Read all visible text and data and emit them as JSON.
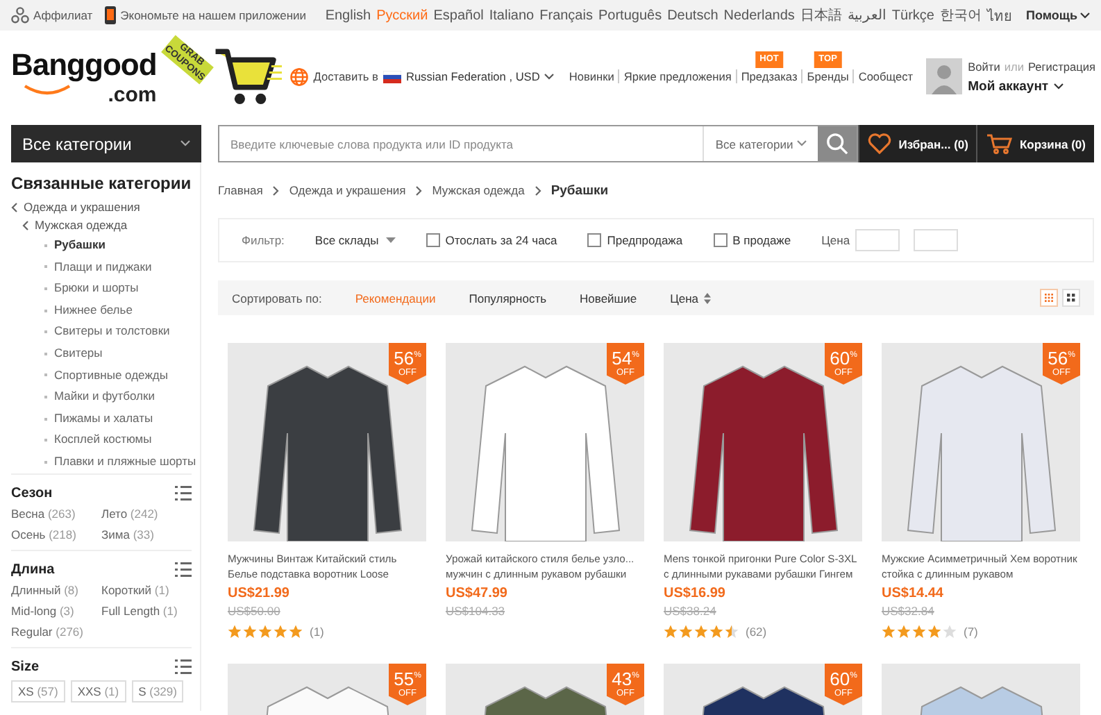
{
  "top_bar": {
    "affiliate": "Аффилиат",
    "app_promo": "Экономьте на нашем приложении",
    "languages": [
      {
        "label": "English",
        "selected": false
      },
      {
        "label": "Русский",
        "selected": true
      },
      {
        "label": "Español",
        "selected": false
      },
      {
        "label": "Italiano",
        "selected": false
      },
      {
        "label": "Français",
        "selected": false
      },
      {
        "label": "Português",
        "selected": false
      },
      {
        "label": "Deutsch",
        "selected": false
      },
      {
        "label": "Nederlands",
        "selected": false
      },
      {
        "label": "日本語",
        "selected": false
      },
      {
        "label": "العربية",
        "selected": false
      },
      {
        "label": "Türkçe",
        "selected": false
      },
      {
        "label": "한국어",
        "selected": false
      },
      {
        "label": "ไทย",
        "selected": false
      }
    ],
    "help": "Помощь"
  },
  "header": {
    "logo": {
      "name": "Banggood",
      "domain": ".com"
    },
    "coupon_ribbon": "GRAB COUPONS",
    "ship_to": {
      "label": "Доставить в",
      "destination": "Russian Federation , USD"
    },
    "nav_links": [
      {
        "label": "Новинки"
      },
      {
        "label": "Яркие предложения"
      },
      {
        "label": "Предзаказ",
        "badge": "HOT"
      },
      {
        "label": "Бренды",
        "badge": "TOP"
      },
      {
        "label": "Сообщест"
      }
    ],
    "account": {
      "login": "Войти",
      "or": "или",
      "register": "Регистрация",
      "title": "Мой аккаунт"
    }
  },
  "nav_bar": {
    "categories_button": "Все категории",
    "search": {
      "placeholder": "Введите ключевые слова продукта или ID продукта",
      "category": "Все категории"
    },
    "wishlist": {
      "label": "Избран...",
      "count": "(0)"
    },
    "cart": {
      "label": "Корзина",
      "count": "(0)"
    }
  },
  "sidebar": {
    "title": "Связанные категории",
    "tree": [
      {
        "label": "Одежда и украшения",
        "children": [
          {
            "label": "Мужская одежда",
            "children": [
              {
                "label": "Рубашки",
                "selected": true
              },
              {
                "label": "Плащи и пиджаки",
                "selected": false
              },
              {
                "label": "Брюки и шорты",
                "selected": false
              },
              {
                "label": "Нижнее белье",
                "selected": false
              },
              {
                "label": "Свитеры и толстовки",
                "selected": false
              },
              {
                "label": "Свитеры",
                "selected": false
              },
              {
                "label": "Спортивные одежды",
                "selected": false
              },
              {
                "label": "Майки и футболки",
                "selected": false
              },
              {
                "label": "Пижамы и халаты",
                "selected": false
              },
              {
                "label": "Косплей костюмы",
                "selected": false
              },
              {
                "label": "Плавки и пляжные шорты",
                "selected": false
              }
            ]
          }
        ]
      }
    ],
    "filters": [
      {
        "title": "Сезон",
        "kind": "options",
        "options": [
          {
            "label": "Весна",
            "count": "(263)"
          },
          {
            "label": "Лето",
            "count": "(242)"
          },
          {
            "label": "Осень",
            "count": "(218)"
          },
          {
            "label": "Зима",
            "count": "(33)"
          }
        ]
      },
      {
        "title": "Длина",
        "kind": "options",
        "options": [
          {
            "label": "Длинный",
            "count": "(8)"
          },
          {
            "label": "Короткий",
            "count": "(1)"
          },
          {
            "label": "Mid-long",
            "count": "(3)"
          },
          {
            "label": "Full Length",
            "count": "(1)"
          },
          {
            "label": "Regular",
            "count": "(276)"
          }
        ]
      },
      {
        "title": "Size",
        "kind": "chips",
        "options": [
          {
            "label": "XS",
            "count": "(57)"
          },
          {
            "label": "XXS",
            "count": "(1)"
          },
          {
            "label": "S",
            "count": "(329)"
          }
        ]
      }
    ]
  },
  "breadcrumb": [
    "Главная",
    "Одежда и украшения",
    "Мужская одежда",
    "Рубашки"
  ],
  "filter_bar": {
    "label": "Фильтр:",
    "warehouse": "Все склады",
    "checkboxes": [
      {
        "label": "Отослать за 24 часа",
        "checked": false
      },
      {
        "label": "Предпродажа",
        "checked": false
      },
      {
        "label": "В продаже",
        "checked": false
      }
    ],
    "price_label": "Цена"
  },
  "sort_bar": {
    "label": "Сортировать по:",
    "options": [
      {
        "label": "Рекомендации",
        "selected": true
      },
      {
        "label": "Популярность",
        "selected": false
      },
      {
        "label": "Новейшие",
        "selected": false
      },
      {
        "label": "Цена",
        "selected": false
      }
    ],
    "views": [
      {
        "kind": "small-grid",
        "selected": true
      },
      {
        "kind": "large-grid",
        "selected": false
      }
    ]
  },
  "products": [
    {
      "color": "#3b3e42",
      "discount": "56$^{%}$",
      "badge_label": "OFF",
      "title": "Мужчины Винтаж Китайский стиль Белье подставка воротник Loose",
      "price": "US$21.99",
      "old_price": "US$50.00",
      "stars": 5,
      "reviews": "(1)"
    },
    {
      "color": "#ffffff",
      "discount": "54$^{%}$",
      "badge_label": "OFF",
      "title": "Урожай китайского стиля белье узло... мужчин с длинным рукавом рубашки",
      "price": "US$47.99",
      "old_price": "US$104.33"
    },
    {
      "color": "#8c1c2c",
      "discount": "60$^{%}$",
      "badge_label": "OFF",
      "title": "Mens тонкой пригонки Pure Color S-3XL с длинными рукавами рубашки Гингем",
      "price": "US$16.99",
      "old_price": "US$38.24",
      "stars": 4.5,
      "reviews": "(62)"
    },
    {
      "color": "#e6e8f0",
      "discount": "56$^{%}$",
      "badge_label": "OFF",
      "title": "Мужские Асимметричный Хем воротник стойка с длинным рукавом",
      "price": "US$14.44",
      "old_price": "US$32.84",
      "stars": 4,
      "reviews": "(7)"
    },
    {
      "color": "#fafafa",
      "discount": "55$^{%}$",
      "badge_label": "OFF"
    },
    {
      "color": "#5b6648",
      "discount": "43$^{%}$",
      "badge_label": "OFF"
    },
    {
      "color": "#1f3160",
      "discount": "60$^{%}$",
      "badge_label": "OFF"
    },
    {
      "color": "#b8cce4"
    }
  ]
}
